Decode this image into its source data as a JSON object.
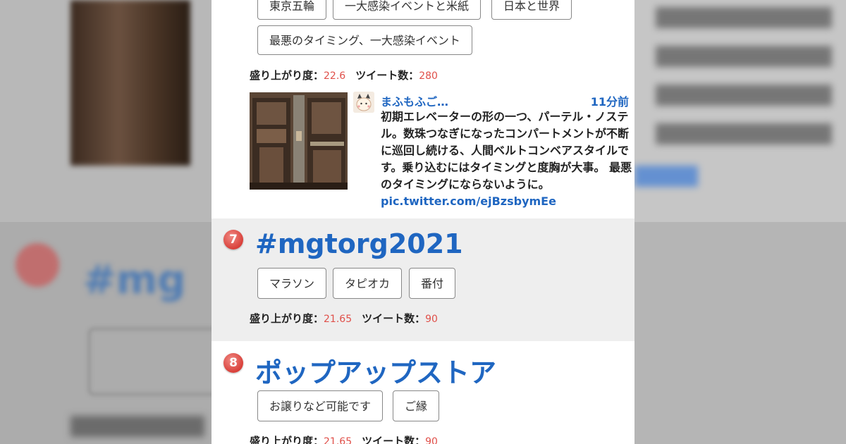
{
  "top_item": {
    "tags_row1": [
      "東京五輪",
      "一大感染イベントと米紙",
      "日本と世界"
    ],
    "tags_row2": [
      "最悪のタイミング、一大感染イベント"
    ],
    "stats": {
      "heat_label": "盛り上がり度：",
      "heat_value": "22.6",
      "tweets_label": "ツイート数：",
      "tweets_value": "280"
    },
    "tweet": {
      "user": "まふもふご…",
      "time": "11分前",
      "text": "初期エレベーターの形の一つ、パーテル・ノステル。数珠つなぎになったコンパートメントが不断に巡回し続ける、人間ベルトコンベアスタイルです。乗り込むにはタイミングと度胸が大事。 最悪のタイミングにならないように。",
      "link": "pic.twitter.com/ejBzsbymEe"
    }
  },
  "item7": {
    "rank": "7",
    "title": "#mgtorg2021",
    "tags": [
      "マラソン",
      "タピオカ",
      "番付"
    ],
    "stats": {
      "heat_label": "盛り上がり度：",
      "heat_value": "21.65",
      "tweets_label": "ツイート数：",
      "tweets_value": "90"
    }
  },
  "item8": {
    "rank": "8",
    "title": "ポップアップストア",
    "tags": [
      "お譲りなど可能です",
      "ご縁"
    ],
    "stats": {
      "heat_label": "盛り上がり度：",
      "heat_value": "21.65",
      "tweets_label": "ツイート数：",
      "tweets_value": "90"
    }
  }
}
